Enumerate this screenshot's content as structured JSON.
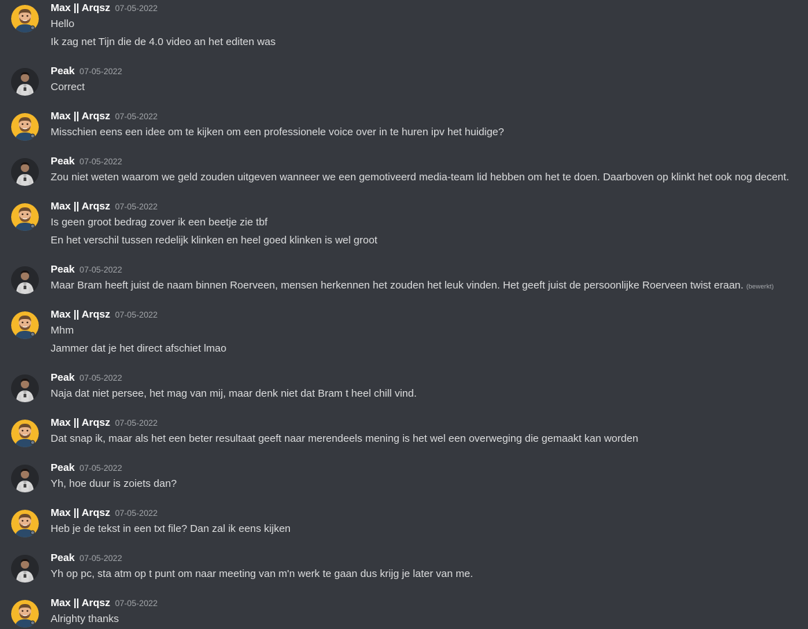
{
  "users": {
    "max": {
      "name": "Max || Arqsz",
      "avatar": "max-avatar"
    },
    "peak": {
      "name": "Peak",
      "avatar": "peak-avatar"
    }
  },
  "colors": {
    "background": "#36393f",
    "text": "#dcddde",
    "username": "#ffffff",
    "timestamp": "#a3a6aa",
    "max_avatar_bg": "#f5b82a"
  },
  "messages": [
    {
      "author": "Max || Arqsz",
      "user": "max",
      "date": "07-05-2022",
      "lines": [
        "Hello",
        "Ik zag net Tijn die de 4.0 video an het editen was"
      ]
    },
    {
      "author": "Peak",
      "user": "peak",
      "date": "07-05-2022",
      "lines": [
        "Correct"
      ]
    },
    {
      "author": "Max || Arqsz",
      "user": "max",
      "date": "07-05-2022",
      "lines": [
        "Misschien eens een idee om te kijken om een professionele voice over in te huren ipv het huidige?"
      ]
    },
    {
      "author": "Peak",
      "user": "peak",
      "date": "07-05-2022",
      "lines": [
        "Zou niet weten waarom we geld zouden uitgeven wanneer we een gemotiveerd media-team lid hebben om het te doen. Daarboven op klinkt het ook nog decent."
      ]
    },
    {
      "author": "Max || Arqsz",
      "user": "max",
      "date": "07-05-2022",
      "lines": [
        "Is geen groot bedrag zover ik een beetje zie tbf",
        "En het verschil tussen redelijk klinken en heel goed klinken is wel groot"
      ]
    },
    {
      "author": "Peak",
      "user": "peak",
      "date": "07-05-2022",
      "lines": [
        "Maar Bram heeft juist de naam binnen Roerveen, mensen herkennen het zouden het leuk vinden. Het geeft juist de persoonlijke Roerveen twist eraan."
      ],
      "edited": "(bewerkt)"
    },
    {
      "author": "Max || Arqsz",
      "user": "max",
      "date": "07-05-2022",
      "lines": [
        "Mhm",
        "Jammer dat je het direct afschiet lmao"
      ]
    },
    {
      "author": "Peak",
      "user": "peak",
      "date": "07-05-2022",
      "lines": [
        "Naja dat niet persee, het mag van mij, maar denk niet dat Bram t heel chill vind."
      ]
    },
    {
      "author": "Max || Arqsz",
      "user": "max",
      "date": "07-05-2022",
      "lines": [
        "Dat snap ik, maar als het een beter resultaat geeft naar merendeels mening is het wel een overweging die gemaakt kan worden"
      ]
    },
    {
      "author": "Peak",
      "user": "peak",
      "date": "07-05-2022",
      "lines": [
        "Yh, hoe duur is zoiets dan?"
      ]
    },
    {
      "author": "Max || Arqsz",
      "user": "max",
      "date": "07-05-2022",
      "lines": [
        "Heb je de tekst in een txt file? Dan zal ik eens kijken"
      ]
    },
    {
      "author": "Peak",
      "user": "peak",
      "date": "07-05-2022",
      "lines": [
        "Yh op pc, sta atm op t punt om naar meeting van m'n werk te gaan dus krijg je later van me."
      ]
    },
    {
      "author": "Max || Arqsz",
      "user": "max",
      "date": "07-05-2022",
      "lines": [
        "Alrighty thanks"
      ]
    }
  ]
}
